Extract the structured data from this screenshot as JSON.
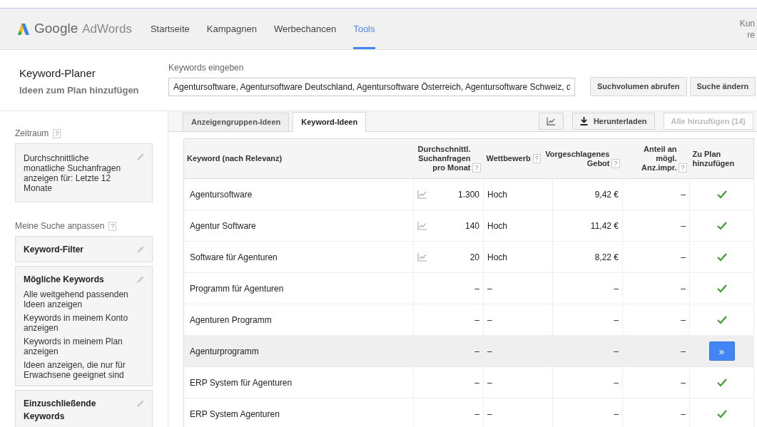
{
  "header": {
    "logo": {
      "google": "Google",
      "product": "AdWords"
    },
    "nav": [
      {
        "label": "Startseite",
        "selected": false
      },
      {
        "label": "Kampagnen",
        "selected": false
      },
      {
        "label": "Werbechancen",
        "selected": false
      },
      {
        "label": "Tools",
        "selected": true
      }
    ],
    "account": [
      "Kun",
      "re"
    ]
  },
  "page": {
    "title": "Keyword-Planer",
    "subtitle": "Ideen zum Plan hinzufügen",
    "keywords_label": "Keywords eingeben",
    "keywords_value": "Agentursoftware, Agentursoftware Deutschland, Agentursoftware Österreich, Agentursoftware Schweiz, d",
    "buttons": [
      "Suchvolumen abrufen",
      "Suche ändern"
    ]
  },
  "sidebar": {
    "sections": [
      {
        "label": "Zeitraum",
        "help": "?",
        "cards": [
          {
            "lines": [
              "Durchschnittliche monatliche Suchanfragen anzeigen für: Letzte 12 Monate"
            ]
          }
        ]
      },
      {
        "label": "Meine Suche anpassen",
        "help": "?",
        "cards": [
          {
            "title": "Keyword-Filter"
          },
          {
            "title": "Mögliche Keywords",
            "lines": [
              "Alle weitgehend passenden Ideen anzeigen",
              "Keywords in meinem Konto anzeigen",
              "Keywords in meinem Plan anzeigen",
              "Ideen anzeigen, die nur für Erwachsene geeignet sind"
            ]
          },
          {
            "title": "Einzuschließende Keywords"
          }
        ]
      }
    ]
  },
  "tabs": [
    {
      "label": "Anzeigengruppen-Ideen",
      "selected": false
    },
    {
      "label": "Keyword-Ideen",
      "selected": true
    }
  ],
  "toolbar": {
    "download": "Herunterladen",
    "add_all": "Alle hinzufügen (14)",
    "add_all_disabled": true
  },
  "table": {
    "columns": [
      {
        "label": "Keyword (nach Relevanz)"
      },
      {
        "label": "Durchschnittl. Suchanfragen pro Monat",
        "help": "?"
      },
      {
        "label": "Wettbewerb",
        "help": "?"
      },
      {
        "label": "Vorgeschlagenes Gebot",
        "help": "?"
      },
      {
        "label": "Anteil an mögl. Anz.impr.",
        "help": "?"
      },
      {
        "label": "Zu Plan hinzufügen"
      }
    ],
    "rows": [
      {
        "keyword": "Agentursoftware",
        "trend": true,
        "searches": "1.300",
        "competition": "Hoch",
        "bid": "9,42 €",
        "share": "–",
        "added": true,
        "highlighted": false
      },
      {
        "keyword": "Agentur Software",
        "trend": true,
        "searches": "140",
        "competition": "Hoch",
        "bid": "11,42 €",
        "share": "–",
        "added": true,
        "highlighted": false
      },
      {
        "keyword": "Software für Agenturen",
        "trend": true,
        "searches": "20",
        "competition": "Hoch",
        "bid": "8,22 €",
        "share": "–",
        "added": true,
        "highlighted": false
      },
      {
        "keyword": "Programm für Agenturen",
        "trend": false,
        "searches": "–",
        "competition": "–",
        "bid": "–",
        "share": "–",
        "added": true,
        "highlighted": false
      },
      {
        "keyword": "Agenturen Programm",
        "trend": false,
        "searches": "–",
        "competition": "–",
        "bid": "–",
        "share": "–",
        "added": true,
        "highlighted": false
      },
      {
        "keyword": "Agenturprogramm",
        "trend": false,
        "searches": "–",
        "competition": "–",
        "bid": "–",
        "share": "–",
        "added": false,
        "add_button": "»",
        "highlighted": true
      },
      {
        "keyword": "ERP System für Agenturen",
        "trend": false,
        "searches": "–",
        "competition": "–",
        "bid": "–",
        "share": "–",
        "added": true,
        "highlighted": false
      },
      {
        "keyword": "ERP System Agenturen",
        "trend": false,
        "searches": "–",
        "competition": "–",
        "bid": "–",
        "share": "–",
        "added": true,
        "highlighted": false
      }
    ]
  }
}
